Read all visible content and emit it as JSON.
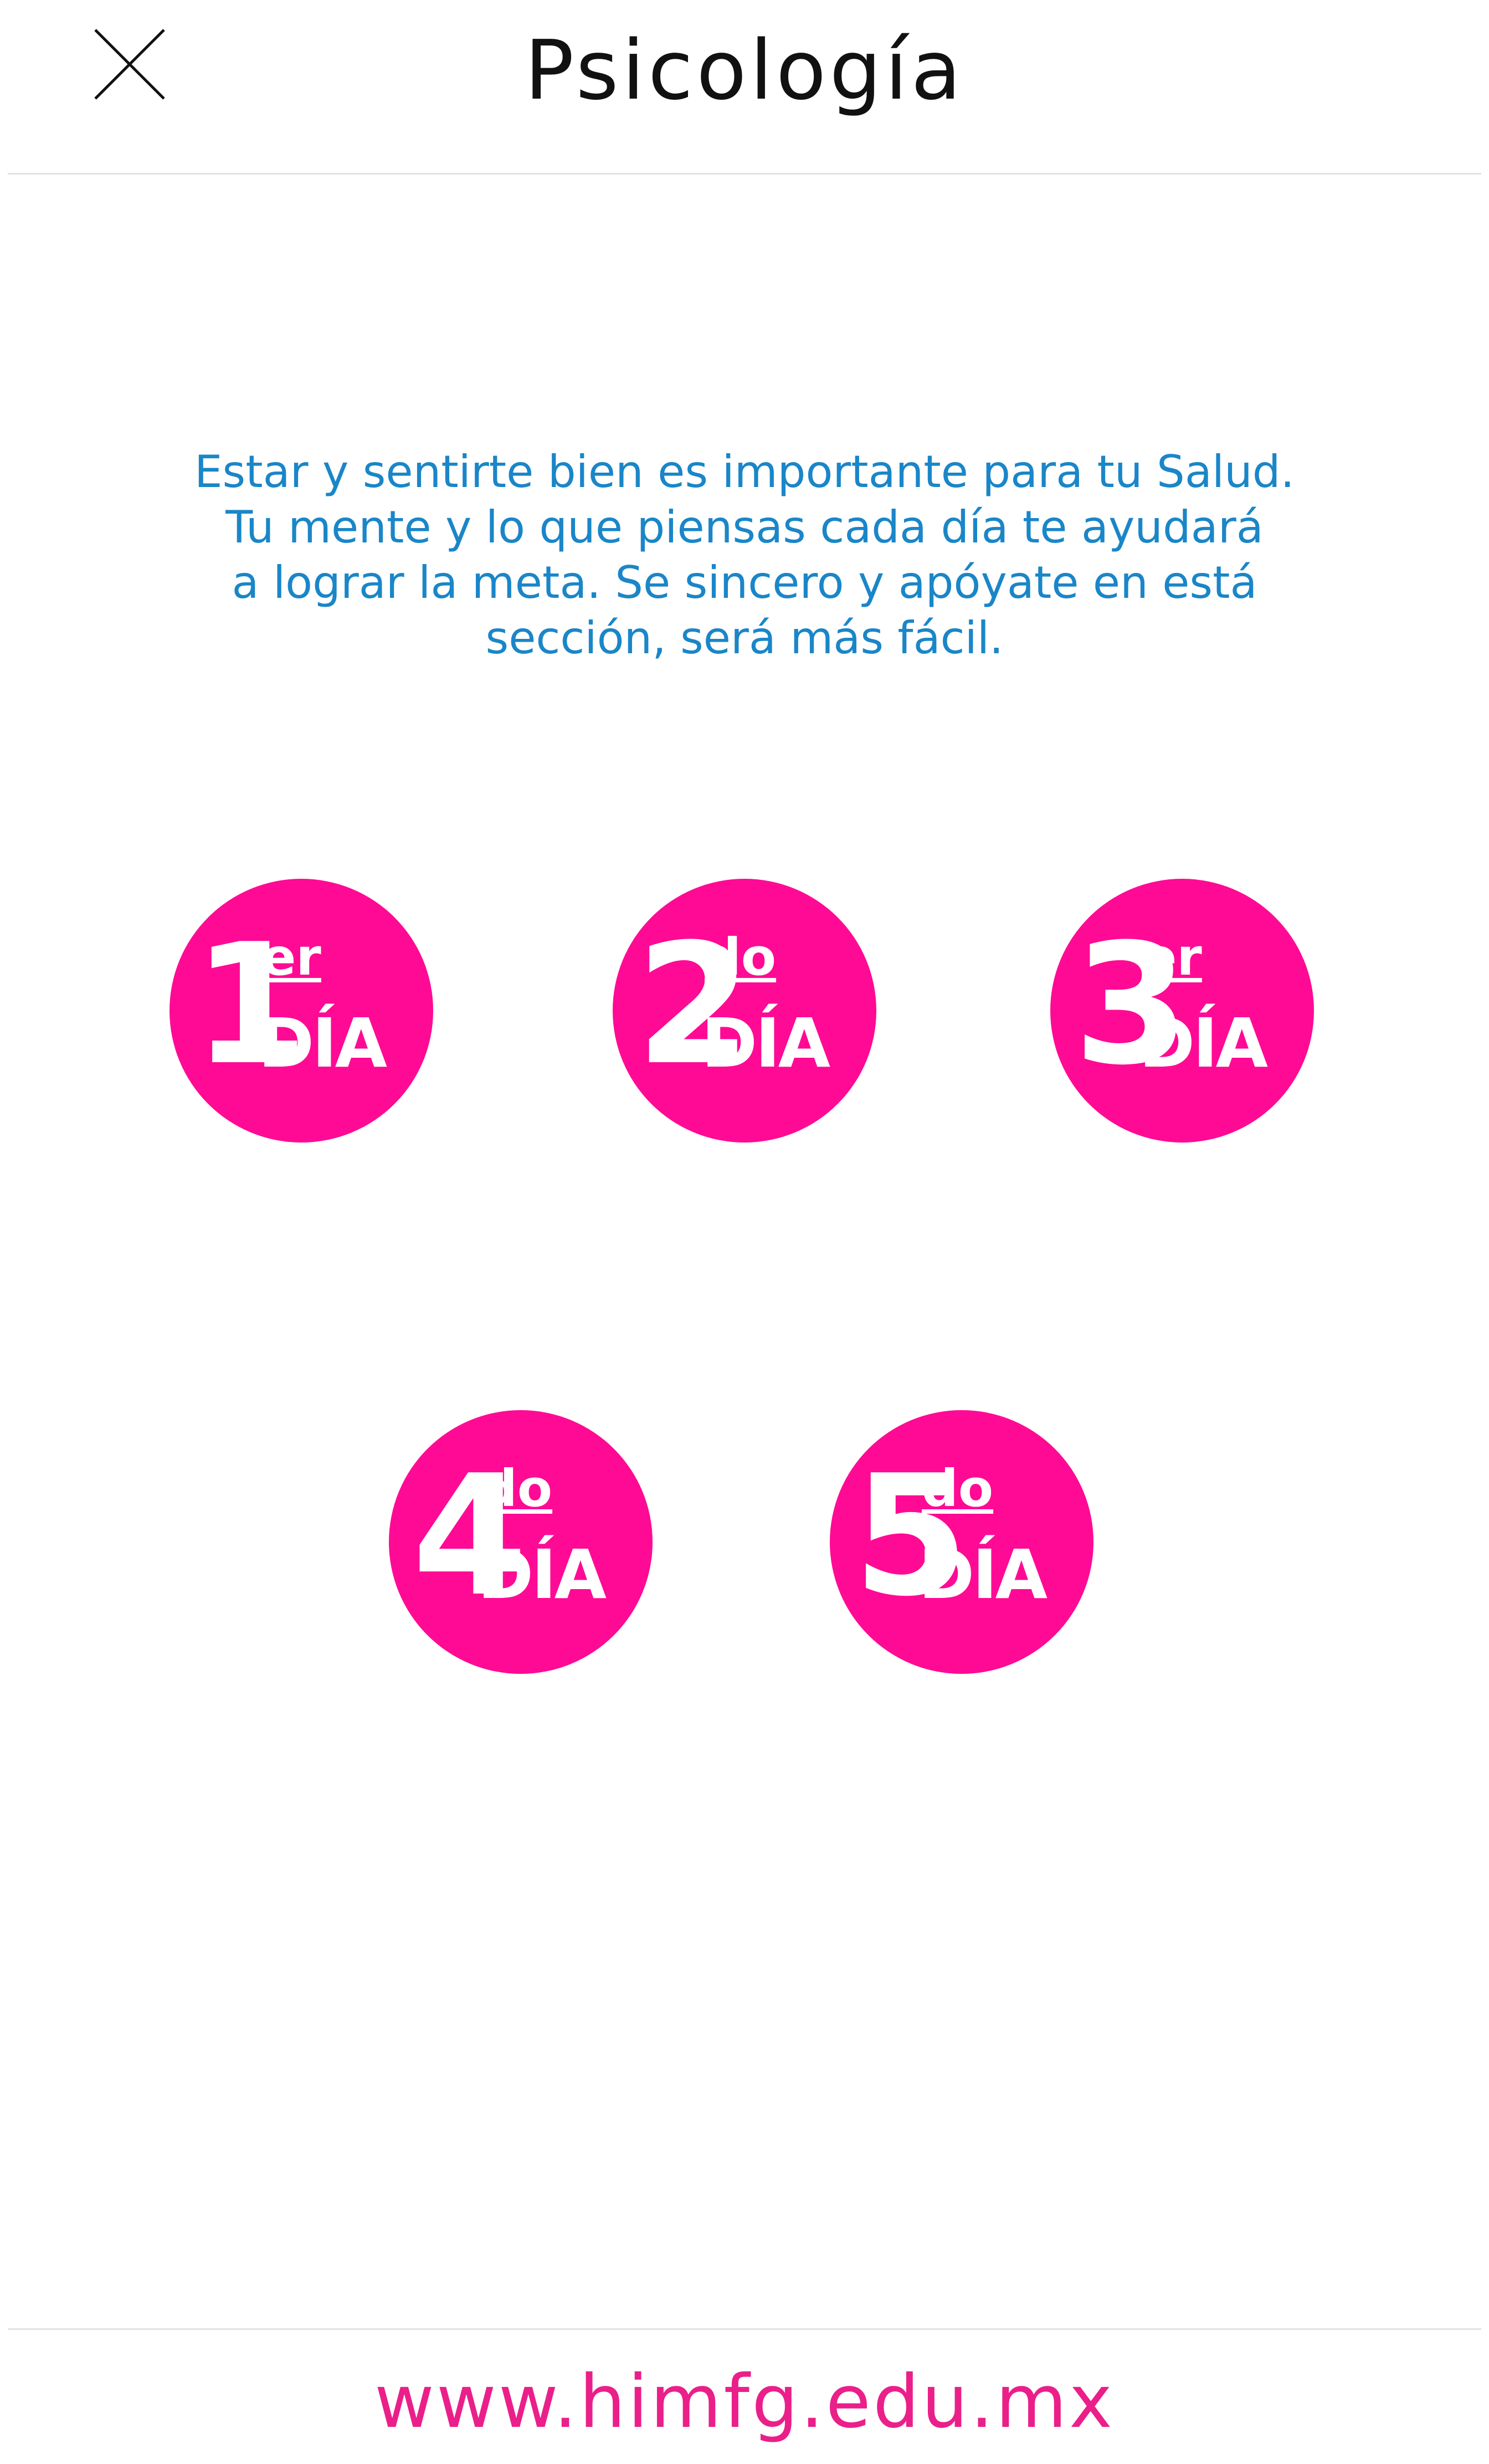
{
  "header": {
    "title": "Psicología",
    "close_icon": "close-icon"
  },
  "intro": {
    "lines": [
      "Estar y sentirte bien es importante para tu Salud.",
      "Tu mente y lo que piensas cada día te ayudará",
      "a lograr la meta. Se sincero y apóyate en está",
      "sección, será más fácil."
    ]
  },
  "days": [
    {
      "number": "1",
      "suffix": "er",
      "word": "DÍA"
    },
    {
      "number": "2",
      "suffix": "do",
      "word": "DÍA"
    },
    {
      "number": "3",
      "suffix": "er",
      "word": "DÍA"
    },
    {
      "number": "4",
      "suffix": "do",
      "word": "DÍA"
    },
    {
      "number": "5",
      "suffix": "do",
      "word": "DÍA"
    }
  ],
  "footer": {
    "url": "www.himfg.edu.mx"
  },
  "colors": {
    "accent": "#ff0a95",
    "intro_text": "#1a86c8",
    "footer_link": "#ea1f8a",
    "title_text": "#111111"
  }
}
